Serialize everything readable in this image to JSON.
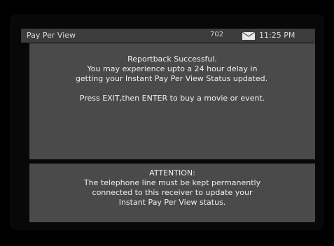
{
  "header": {
    "title": "Pay Per View",
    "channel": "702",
    "time": "11:25 PM",
    "mail_icon": "envelope-icon"
  },
  "message": {
    "line1": "Reportback Successful.",
    "line2": "You may experience upto a 24 hour delay in",
    "line3": "getting your Instant Pay Per View Status updated.",
    "line4": "Press EXIT,then ENTER to buy a movie or event."
  },
  "attention": {
    "heading": "ATTENTION:",
    "line1": "The telephone line must be kept permanently",
    "line2": "connected to this receiver to update your",
    "line3": "Instant Pay Per View status."
  }
}
